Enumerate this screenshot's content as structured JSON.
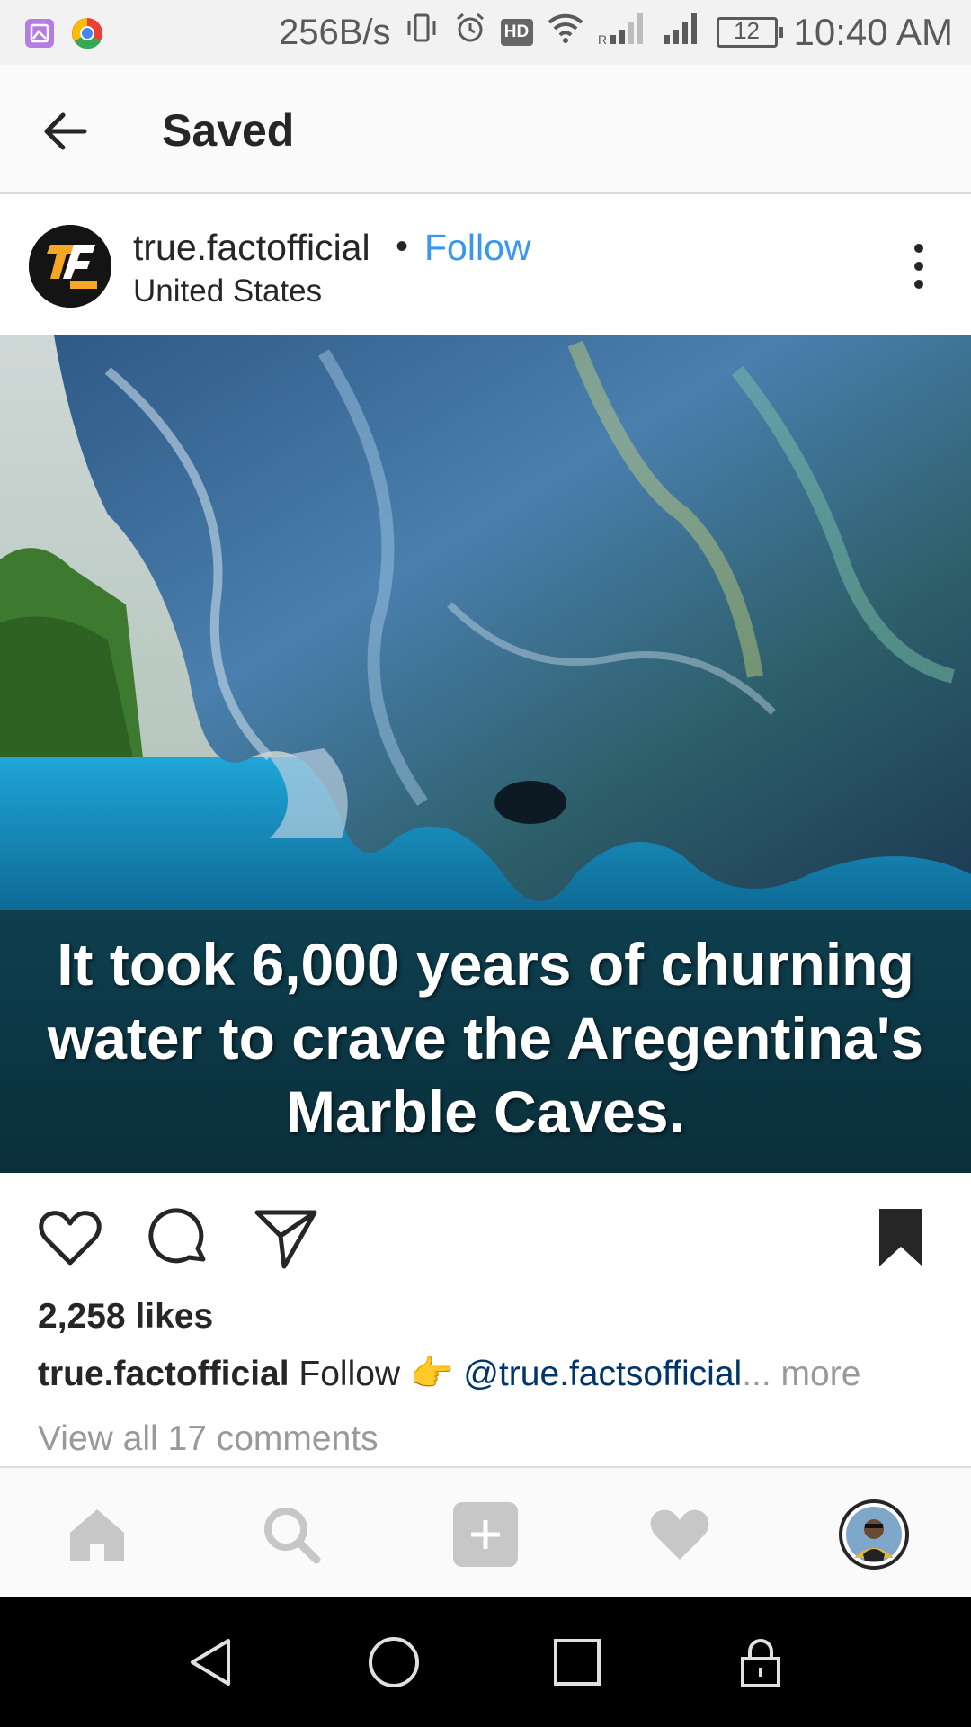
{
  "status_bar": {
    "net_speed": "256B/s",
    "battery": "12",
    "time": "10:40 AM",
    "hd_label": "HD",
    "icons": [
      "gallery-app-icon",
      "chrome-icon",
      "vibrate-icon",
      "alarm-icon",
      "hd-icon",
      "wifi-icon",
      "signal-r-icon",
      "signal-icon",
      "battery-icon"
    ]
  },
  "app_bar": {
    "back_icon": "arrow-left-icon",
    "title": "Saved"
  },
  "post": {
    "username": "true.factofficial",
    "separator": "•",
    "follow_label": "Follow",
    "location": "United States",
    "more_icon": "vertical-ellipsis-icon",
    "image_text": {
      "line1": "It took 6,000 years of churning",
      "line2": "water to crave the Aregentina's",
      "line3": "Marble Caves."
    },
    "actions": {
      "like_icon": "heart-outline-icon",
      "comment_icon": "comment-icon",
      "share_icon": "paper-plane-icon",
      "save_icon": "bookmark-filled-icon"
    },
    "likes": "2,258 likes",
    "caption": {
      "user": "true.factofficial",
      "text": " Follow ",
      "emoji": "👉",
      "mention": "@true.factsofficial",
      "ellipsis": "...",
      "more": " more"
    },
    "view_comments": "View all 17 comments"
  },
  "bottom_nav": {
    "items": [
      "home-icon",
      "search-icon",
      "add-post-icon",
      "activity-heart-icon",
      "profile-avatar"
    ]
  },
  "system_nav": {
    "items": [
      "back-triangle-icon",
      "home-circle-icon",
      "recents-square-icon",
      "lock-icon"
    ]
  },
  "colors": {
    "link_blue": "#3897f0",
    "mention_blue": "#003569",
    "muted_gray": "#999999",
    "text": "#262626"
  }
}
